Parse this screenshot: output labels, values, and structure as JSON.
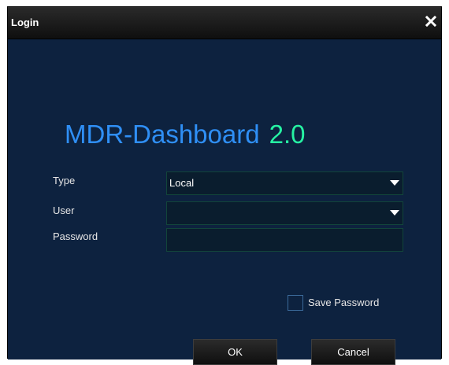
{
  "window": {
    "title": "Login",
    "close_icon": "close-icon"
  },
  "brand": {
    "name": "MDR-Dashboard",
    "version": "2.0",
    "name_color": "#2f8ff5",
    "version_color": "#26f2a3"
  },
  "form": {
    "type": {
      "label": "Type",
      "value": "Local",
      "icon": "chevron-down-icon"
    },
    "user": {
      "label": "User",
      "value": "",
      "icon": "chevron-down-icon"
    },
    "password": {
      "label": "Password",
      "value": ""
    },
    "save_password": {
      "label": "Save Password",
      "checked": false
    }
  },
  "buttons": {
    "ok": "OK",
    "cancel": "Cancel"
  }
}
